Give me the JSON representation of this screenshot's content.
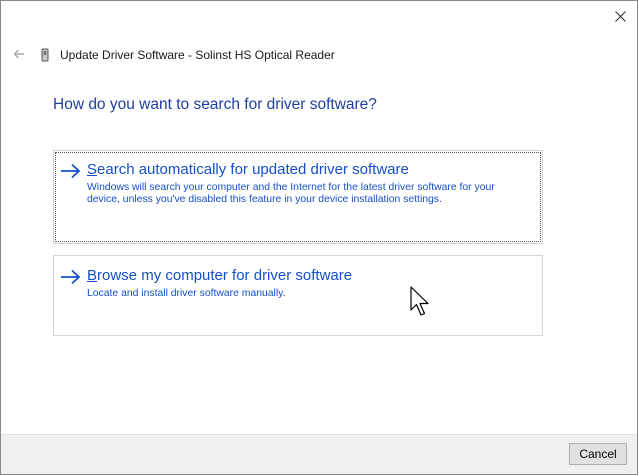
{
  "window": {
    "title": "Update Driver Software - Solinst HS Optical Reader",
    "close_icon": "close-icon",
    "back_icon": "back-arrow-icon",
    "device_icon": "device-icon"
  },
  "heading": "How do you want to search for driver software?",
  "options": [
    {
      "accel": "S",
      "title_rest": "earch automatically for updated driver software",
      "description": "Windows will search your computer and the Internet for the latest driver software for your device, unless you've disabled this feature in your device installation settings.",
      "icon": "arrow-right-icon",
      "focused": true
    },
    {
      "accel": "B",
      "title_rest": "rowse my computer for driver software",
      "description": "Locate and install driver software manually.",
      "icon": "arrow-right-icon",
      "focused": false
    }
  ],
  "footer": {
    "cancel_label": "Cancel"
  },
  "colors": {
    "link_blue": "#1550c8",
    "heading_blue": "#1f3f9e",
    "footer_bg": "#f0f0f0"
  }
}
